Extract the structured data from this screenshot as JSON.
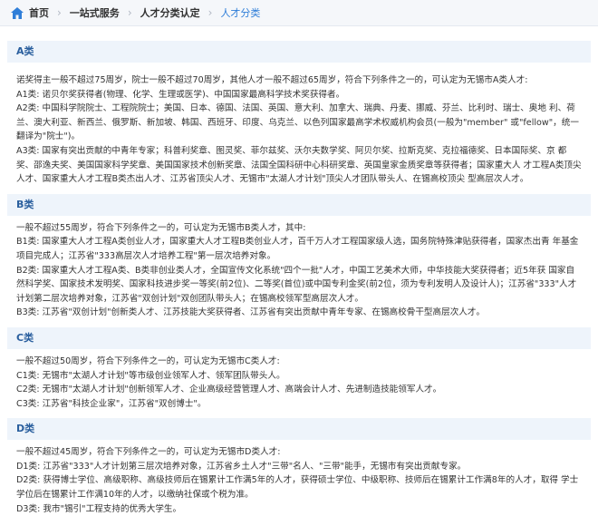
{
  "breadcrumb": {
    "home": "首页",
    "items": [
      "一站式服务",
      "人才分类认定",
      "人才分类"
    ]
  },
  "sections": [
    {
      "title": "A类",
      "lines": [
        "诺奖得主一般不超过75周岁，院士一般不超过70周岁，其他人才一般不超过65周岁，符合下列条件之一的，可认定为无锡市A类人才:",
        "A1类: 诺贝尔奖获得者(物理、化学、生理或医学)、中国国家最高科学技术奖获得者。",
        "A2类: 中国科学院院士、工程院院士；美国、日本、德国、法国、英国、意大利、加拿大、瑞典、丹麦、挪威、芬兰、比利时、瑞士、奥地 利、荷兰、澳大利亚、新西兰、俄罗斯、新加坡、韩国、西班牙、印度、乌克兰、以色列国家最高学术权威机构会员(一般为\"member\" 或\"fellow\"，统一翻译为\"院士\")。",
        "A3类: 国家有突出贡献的中青年专家；科普利奖章、图灵奖、菲尔兹奖、沃尔夫数学奖、阿贝尔奖、拉斯克奖、克拉福德奖、日本国际奖、京 都奖、邵逸夫奖、美国国家科学奖章、美国国家技术创新奖章、法国全国科研中心科研奖章、英国皇家金质奖章等获得者；国家重大人 才工程A类顶尖人才、国家重大人才工程B类杰出人才、江苏省顶尖人才、无锡市\"太湖人才计划\"顶尖人才团队带头人、在锡高校顶尖 型高层次人才。"
      ]
    },
    {
      "title": "B类",
      "lines": [
        "一般不超过55周岁，符合下列条件之一的，可认定为无锡市B类人才，其中:",
        "B1类: 国家重大人才工程A类创业人才，国家重大人才工程B类创业人才，百千万人才工程国家级人选，国务院特殊津贴获得者，国家杰出青 年基金项目完成人；江苏省\"333高层次人才培养工程\"第一层次培养对象。",
        "B2类: 国家重大人才工程A类、B类非创业类人才，全国宣传文化系统\"四个一批\"人才，中国工艺美术大师，中华技能大奖获得者；近5年获 国家自然科学奖、国家技术发明奖、国家科技进步奖一等奖(前2位)、二等奖(首位)或中国专利金奖(前2位，须为专利发明人及设计人)；江苏省\"333\"人才计划第二层次培养对象，江苏省\"双创计划\"双创团队带头人；在锡高校领军型高层次人才。",
        "B3类: 江苏省\"双创计划\"创新类人才、江苏技能大奖获得者、江苏省有突出贡献中青年专家、在锡高校骨干型高层次人才。"
      ]
    },
    {
      "title": "C类",
      "lines": [
        "一般不超过50周岁，符合下列条件之一的，可认定为无锡市C类人才:",
        "C1类: 无锡市\"太湖人才计划\"等市级创业领军人才、领军团队带头人。",
        "C2类: 无锡市\"太湖人才计划\"创新领军人才、企业高级经营管理人才、高端会计人才、先进制造技能领军人才。",
        "C3类: 江苏省\"科技企业家\"，江苏省\"双创博士\"。"
      ]
    },
    {
      "title": "D类",
      "lines": [
        "一般不超过45周岁，符合下列条件之一的，可认定为无锡市D类人才:",
        "D1类: 江苏省\"333\"人才计划第三层次培养对象，江苏省乡土人才\"三带\"名人、\"三带\"能手，无锡市有突出贡献专家。",
        "D2类: 获得博士学位、高级职称、高级技师后在锡累计工作满5年的人才，获得硕士学位、中级职称、技师后在锡累计工作满8年的人才，取得 学士学位后在锡累计工作满10年的人才，以缴纳社保或个税为准。",
        "D3类: 我市\"锡引\"工程支持的优秀大学生。"
      ]
    }
  ],
  "colors": {
    "accent": "#2f7ed8",
    "section_bg": "#eef4fb",
    "title_text": "#2a5f9e"
  }
}
